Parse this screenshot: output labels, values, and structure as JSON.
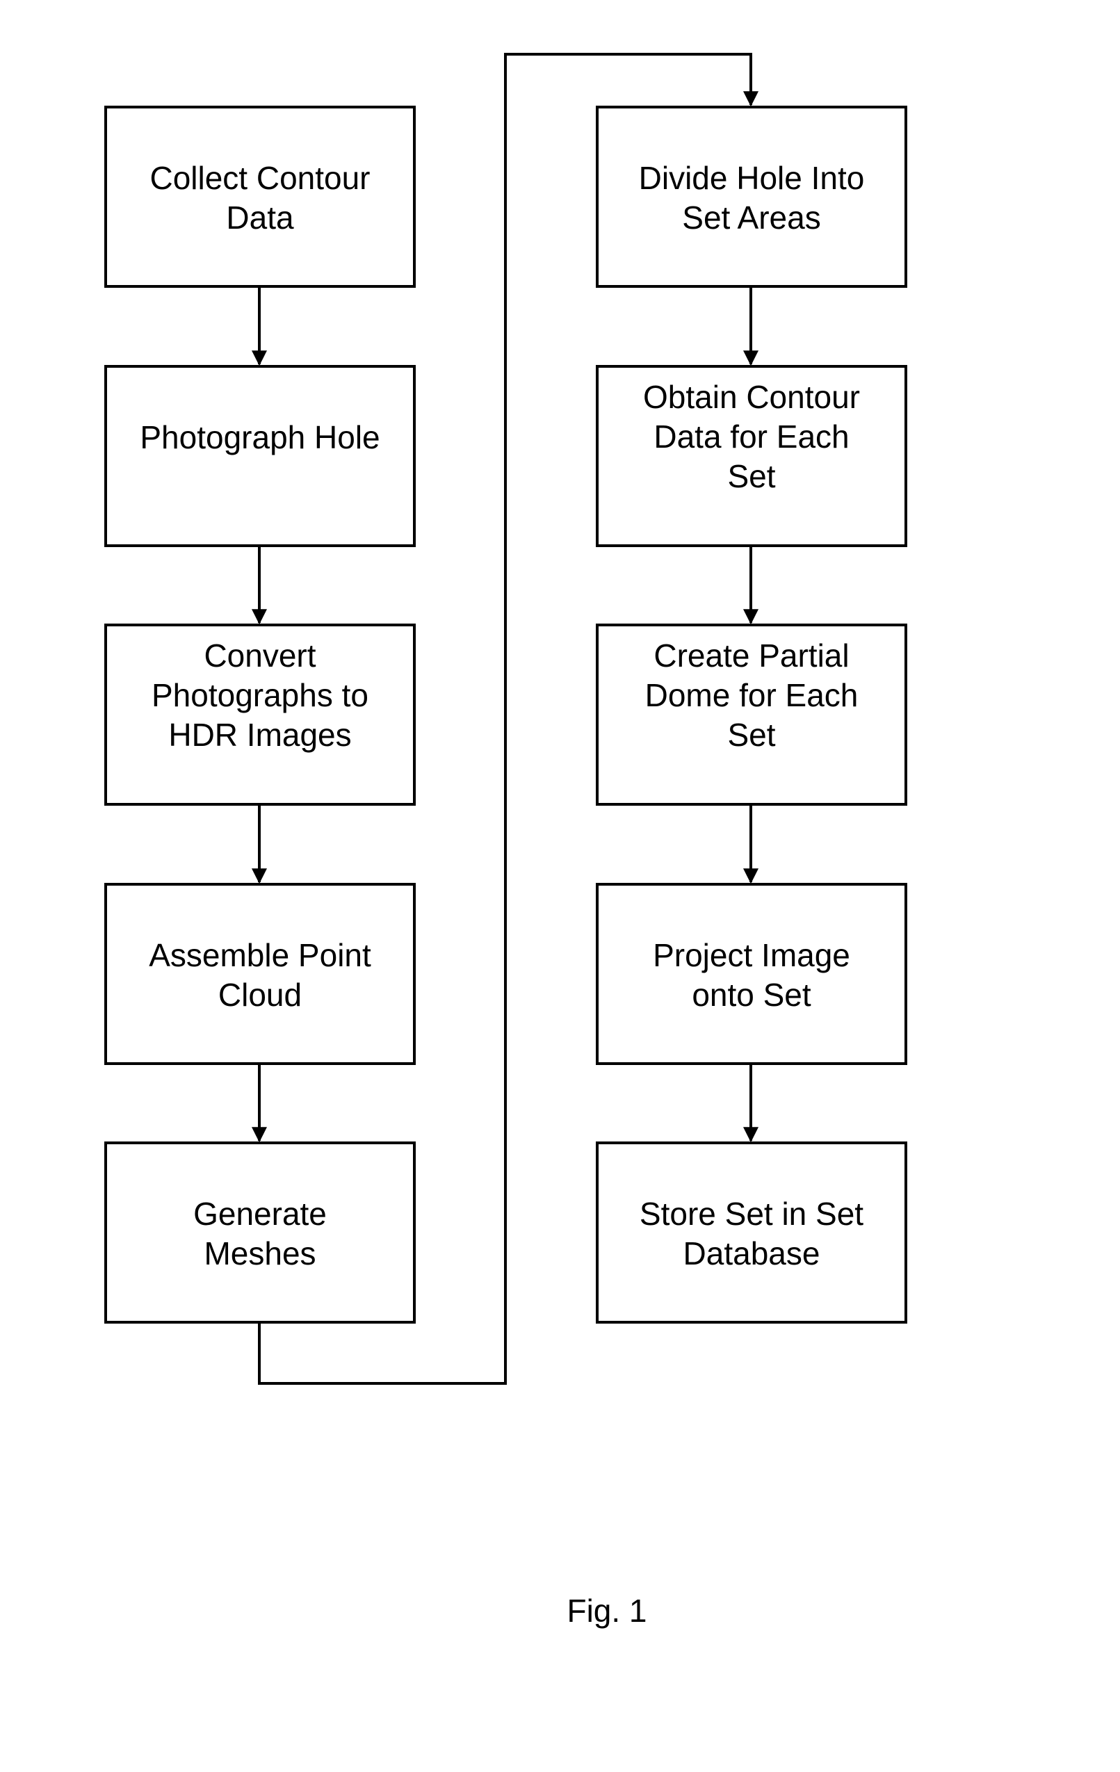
{
  "diagram": {
    "type": "flowchart",
    "left_column": [
      {
        "id": "collect",
        "label": "Collect Contour\nData"
      },
      {
        "id": "photograph",
        "label": "Photograph Hole"
      },
      {
        "id": "convert",
        "label": "Convert\nPhotographs to\nHDR Images"
      },
      {
        "id": "assemble",
        "label": "Assemble Point\nCloud"
      },
      {
        "id": "generate",
        "label": "Generate\nMeshes"
      }
    ],
    "right_column": [
      {
        "id": "divide",
        "label": "Divide Hole Into\nSet Areas"
      },
      {
        "id": "obtain",
        "label": "Obtain Contour\nData for Each\nSet"
      },
      {
        "id": "create",
        "label": "Create Partial\nDome for Each\nSet"
      },
      {
        "id": "project",
        "label": "Project Image\nonto Set"
      },
      {
        "id": "store",
        "label": "Store Set in Set\nDatabase"
      }
    ],
    "edges": [
      [
        "collect",
        "photograph"
      ],
      [
        "photograph",
        "convert"
      ],
      [
        "convert",
        "assemble"
      ],
      [
        "assemble",
        "generate"
      ],
      [
        "generate",
        "divide"
      ],
      [
        "divide",
        "obtain"
      ],
      [
        "obtain",
        "create"
      ],
      [
        "create",
        "project"
      ],
      [
        "project",
        "store"
      ]
    ],
    "caption": "Fig. 1"
  }
}
